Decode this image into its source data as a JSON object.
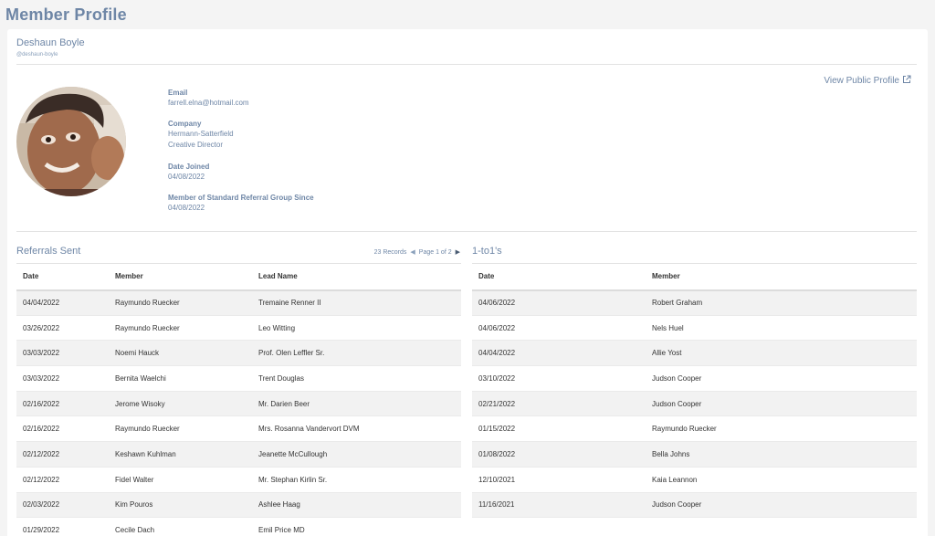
{
  "page_title": "Member Profile",
  "member": {
    "name": "Deshaun Boyle",
    "handle": "@deshaun-boyle",
    "view_public_label": "View Public Profile",
    "fields": [
      {
        "label": "Email",
        "values": [
          "farrell.elna@hotmail.com"
        ]
      },
      {
        "label": "Company",
        "values": [
          "Hermann-Satterfield",
          "Creative Director"
        ]
      },
      {
        "label": "Date Joined",
        "values": [
          "04/08/2022"
        ]
      },
      {
        "label": "Member of Standard Referral Group Since",
        "values": [
          "04/08/2022"
        ]
      }
    ]
  },
  "referrals": {
    "title": "Referrals Sent",
    "records": "23 Records",
    "page": "Page 1 of 2",
    "columns": [
      "Date",
      "Member",
      "Lead Name"
    ],
    "rows": [
      [
        "04/04/2022",
        "Raymundo Ruecker",
        "Tremaine Renner II"
      ],
      [
        "03/26/2022",
        "Raymundo Ruecker",
        "Leo Witting"
      ],
      [
        "03/03/2022",
        "Noemi Hauck",
        "Prof. Olen Leffler Sr."
      ],
      [
        "03/03/2022",
        "Bernita Waelchi",
        "Trent Douglas"
      ],
      [
        "02/16/2022",
        "Jerome Wisoky",
        "Mr. Darien Beer"
      ],
      [
        "02/16/2022",
        "Raymundo Ruecker",
        "Mrs. Rosanna Vandervort DVM"
      ],
      [
        "02/12/2022",
        "Keshawn Kuhlman",
        "Jeanette McCullough"
      ],
      [
        "02/12/2022",
        "Fidel Walter",
        "Mr. Stephan Kirlin Sr."
      ],
      [
        "02/03/2022",
        "Kim Pouros",
        "Ashlee Haag"
      ],
      [
        "01/29/2022",
        "Cecile Dach",
        "Emil Price MD"
      ]
    ]
  },
  "one_to_ones": {
    "title": "1-to1's",
    "columns": [
      "Date",
      "Member"
    ],
    "rows": [
      [
        "04/06/2022",
        "Robert Graham"
      ],
      [
        "04/06/2022",
        "Nels Huel"
      ],
      [
        "04/04/2022",
        "Allie Yost"
      ],
      [
        "03/10/2022",
        "Judson Cooper"
      ],
      [
        "02/21/2022",
        "Judson Cooper"
      ],
      [
        "01/15/2022",
        "Raymundo Ruecker"
      ],
      [
        "01/08/2022",
        "Bella Johns"
      ],
      [
        "12/10/2021",
        "Kaia Leannon"
      ],
      [
        "11/16/2021",
        "Judson Cooper"
      ]
    ]
  }
}
